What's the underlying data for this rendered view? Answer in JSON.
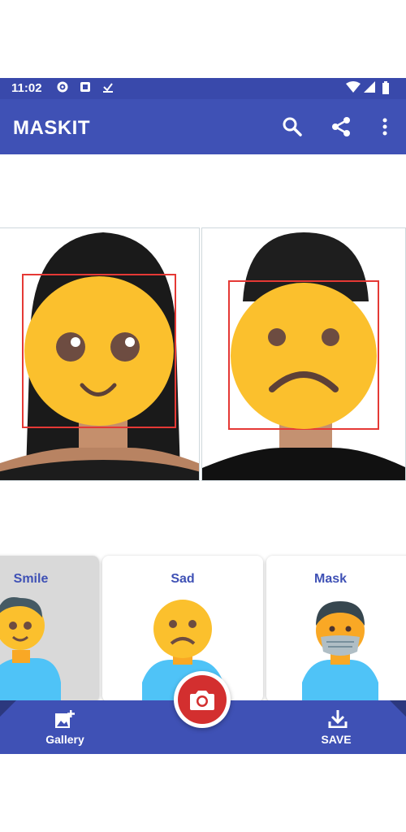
{
  "status_bar": {
    "time": "11:02",
    "left_icons": [
      "settings-icon",
      "image-notification-icon",
      "download-done-icon"
    ],
    "right_icons": [
      "wifi-icon",
      "signal-icon",
      "battery-icon"
    ]
  },
  "app_bar": {
    "title": "MASKIT",
    "actions": [
      "search-icon",
      "share-icon",
      "more-vert-icon"
    ]
  },
  "photos": [
    {
      "mask": "smile"
    },
    {
      "mask": "sad"
    }
  ],
  "mask_options": {
    "selected": "Smile",
    "items": [
      {
        "label": "Smile"
      },
      {
        "label": "Sad"
      },
      {
        "label": "Mask"
      }
    ]
  },
  "bottom_bar": {
    "gallery_label": "Gallery",
    "save_label": "SAVE"
  },
  "colors": {
    "primary": "#3f51b5",
    "status": "#3949ab",
    "accent": "#d32f2f",
    "face_box": "#e53935",
    "emoji_yellow": "#fbc02d",
    "selected_card": "#d9d9d9"
  }
}
